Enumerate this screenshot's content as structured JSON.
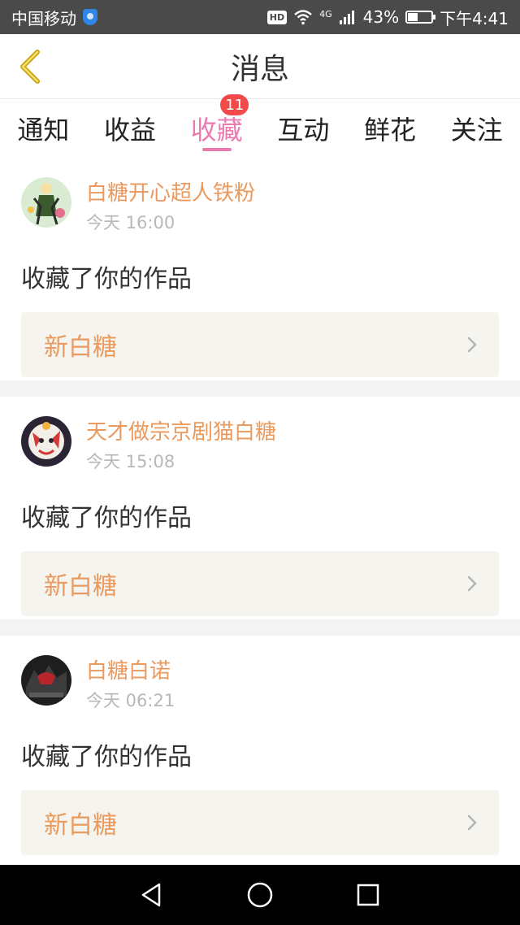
{
  "status_bar": {
    "carrier": "中国移动",
    "network": "4G",
    "battery": "43%",
    "time": "下午4:41"
  },
  "header": {
    "title": "消息"
  },
  "tabs": [
    {
      "label": "通知"
    },
    {
      "label": "收益"
    },
    {
      "label": "收藏",
      "badge": "11",
      "active": true
    },
    {
      "label": "互动"
    },
    {
      "label": "鲜花"
    },
    {
      "label": "关注"
    }
  ],
  "feed": [
    {
      "user": "白糖开心超人铁粉",
      "time": "今天 16:00",
      "action": "收藏了你的作品",
      "work": "新白糖"
    },
    {
      "user": "天才做宗京剧猫白糖",
      "time": "今天 15:08",
      "action": "收藏了你的作品",
      "work": "新白糖"
    },
    {
      "user": "白糖白诺",
      "time": "今天 06:21",
      "action": "收藏了你的作品",
      "work": "新白糖"
    }
  ],
  "colors": {
    "accent_pink": "#e97bb0",
    "name_orange": "#ea9a5e",
    "badge_red": "#f24a4a",
    "back_gold": "#c9a515"
  },
  "icons": {
    "back": "chevron-left-icon",
    "wifi": "wifi-icon",
    "signal": "signal-icon",
    "battery": "battery-icon",
    "chevron": "chevron-right-icon",
    "nav_back": "triangle-back-icon",
    "nav_home": "circle-home-icon",
    "nav_recent": "square-recent-icon"
  }
}
